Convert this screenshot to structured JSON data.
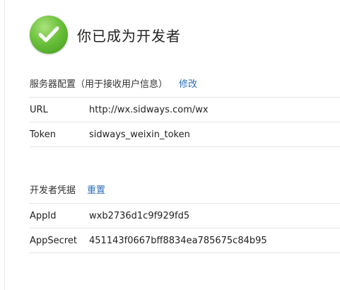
{
  "header": {
    "title": "你已成为开发者",
    "icon": "check-circle-icon",
    "icon_color": "#6cc13c"
  },
  "server_config": {
    "title": "服务器配置（用于接收用户信息）",
    "edit_link": "修改",
    "rows": [
      {
        "label": "URL",
        "value": "http://wx.sidways.com/wx"
      },
      {
        "label": "Token",
        "value": "sidways_weixin_token"
      }
    ]
  },
  "credentials": {
    "title": "开发者凭据",
    "reset_link": "重置",
    "rows": [
      {
        "label": "AppId",
        "value": "wxb2736d1c9f929fd5"
      },
      {
        "label": "AppSecret",
        "value": "451143f0667bff8834ea785675c84b95"
      }
    ]
  },
  "colors": {
    "link": "#2a6ebb",
    "divider": "#e4e4e4"
  }
}
